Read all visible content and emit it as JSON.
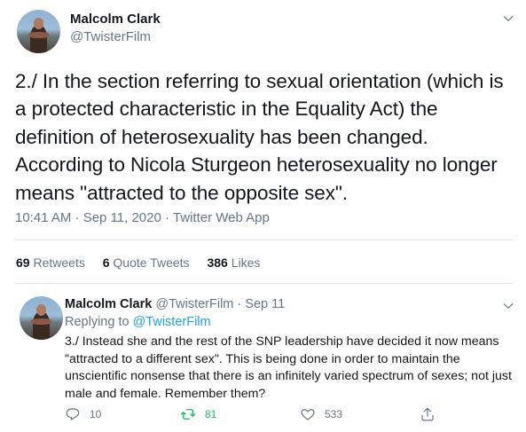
{
  "main_tweet": {
    "author_name": "Malcolm Clark",
    "author_handle": "@TwisterFilm",
    "text": "2./ In the section referring to sexual orientation (which is a protected characteristic in the Equality Act) the definition of heterosexuality has been changed. According to Nicola Sturgeon heterosexuality no longer means \"attracted to the opposite sex\".",
    "meta": "10:41 AM · Sep 11, 2020 · Twitter Web App",
    "stats": {
      "retweets_count": "69",
      "retweets_label": "Retweets",
      "quote_count": "6",
      "quote_label": "Quote Tweets",
      "likes_count": "386",
      "likes_label": "Likes"
    }
  },
  "reply_tweet": {
    "author_name": "Malcolm Clark",
    "author_handle": "@TwisterFilm",
    "separator": "·",
    "date": "Sep 11",
    "replying_prefix": "Replying to",
    "replying_to": "@TwisterFilm",
    "text": "3./ Instead she and the rest of the SNP leadership have decided it now means \"attracted to a different sex\". This is being done in order to maintain the unscientific nonsense that there is an infinitely varied spectrum of sexes; not just male and female. Remember them?",
    "actions": {
      "replies": "10",
      "retweets": "81",
      "likes": "533"
    }
  },
  "colors": {
    "text_primary": "#14171a",
    "text_secondary": "#657786",
    "link": "#1da1f2",
    "retweet_active": "#17bf63",
    "divider": "#e1e8ed"
  },
  "icons": [
    "chevron-down-icon",
    "reply-icon",
    "retweet-icon",
    "like-icon",
    "share-icon"
  ]
}
